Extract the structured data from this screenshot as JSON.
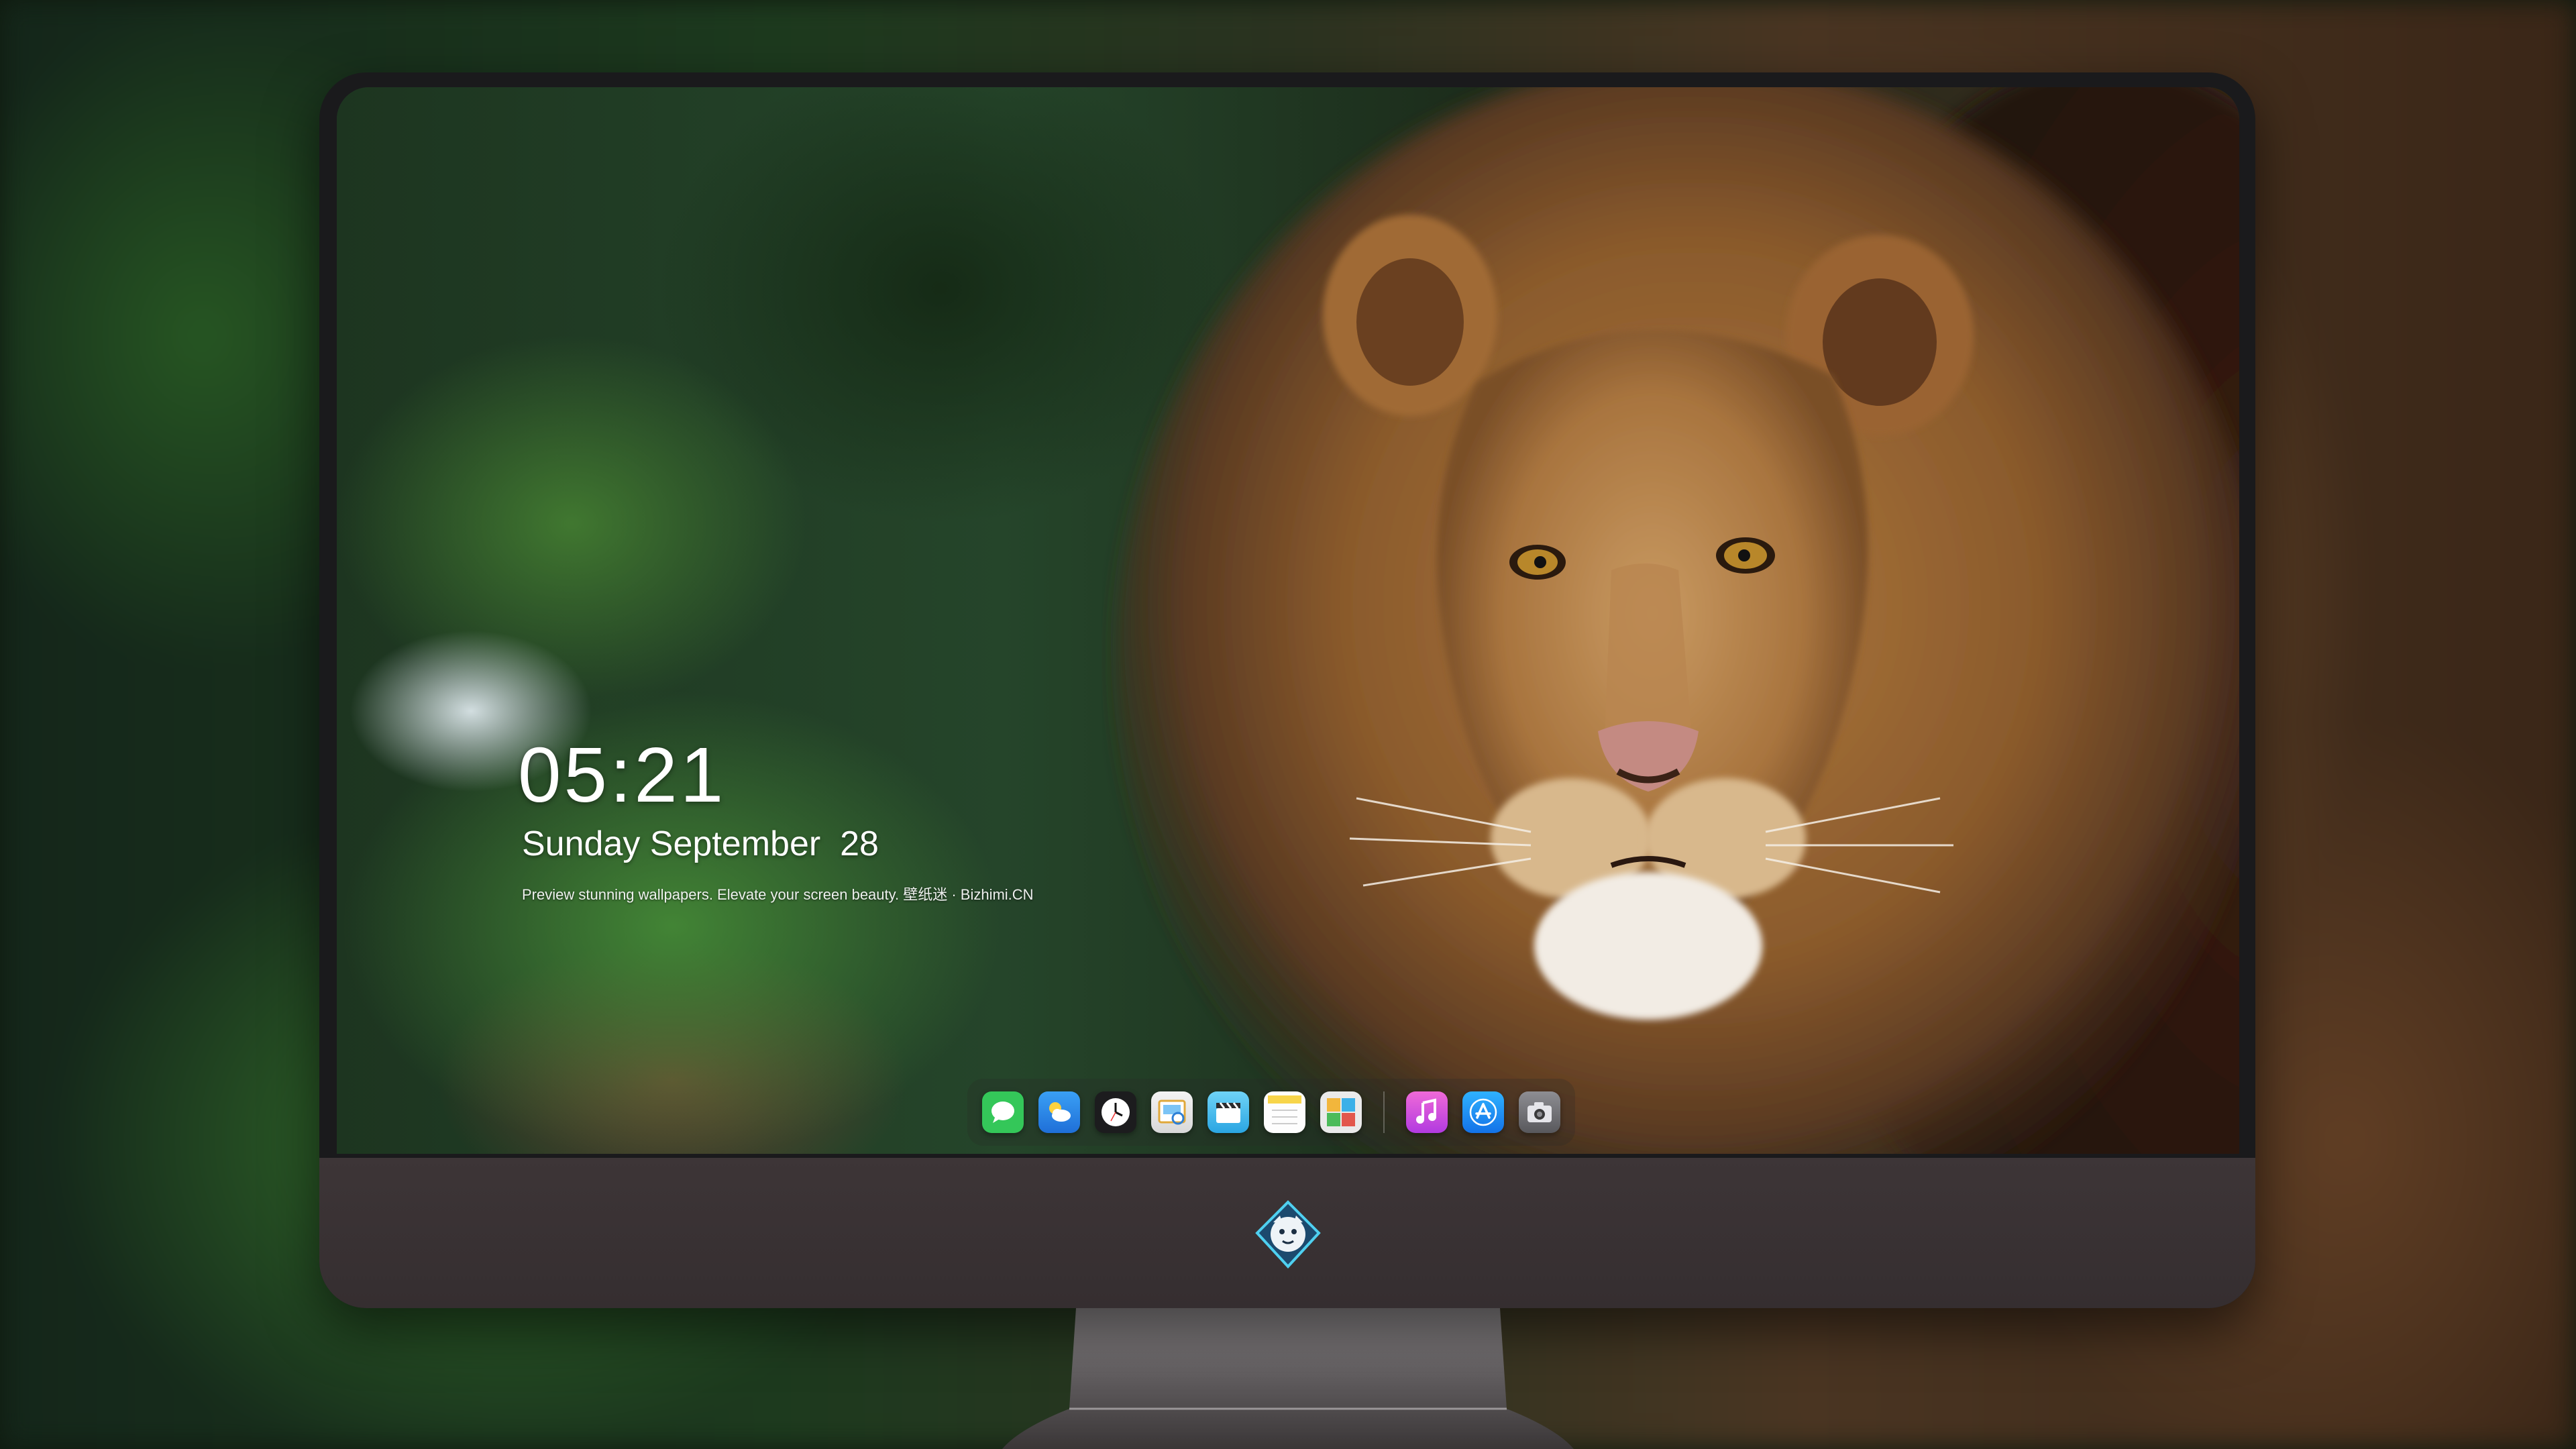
{
  "lockscreen": {
    "time": "05:21",
    "date": "Sunday September  28",
    "tagline": "Preview stunning wallpapers. Elevate your screen beauty. 壁纸迷 · Bizhimi.CN"
  },
  "dock": {
    "apps": [
      {
        "icon": "messages-icon",
        "color": "#34c759"
      },
      {
        "icon": "weather-icon",
        "color": "#2b8ff0"
      },
      {
        "icon": "clock-icon",
        "color": "#1c1c1e"
      },
      {
        "icon": "preview-icon",
        "color": "#e9b64a"
      },
      {
        "icon": "clips-icon",
        "color": "#3bb6e8"
      },
      {
        "icon": "notes-icon",
        "color": "#f7d54a"
      },
      {
        "icon": "photo-booth-icon",
        "color": "#e8e8e8"
      },
      {
        "icon": "music-icon",
        "color": "#e04fd0"
      },
      {
        "icon": "app-store-icon",
        "color": "#1e8ef5"
      },
      {
        "icon": "camera-icon",
        "color": "#6e6e73"
      }
    ]
  },
  "chin": {
    "logo": "bizhimi-logo"
  }
}
